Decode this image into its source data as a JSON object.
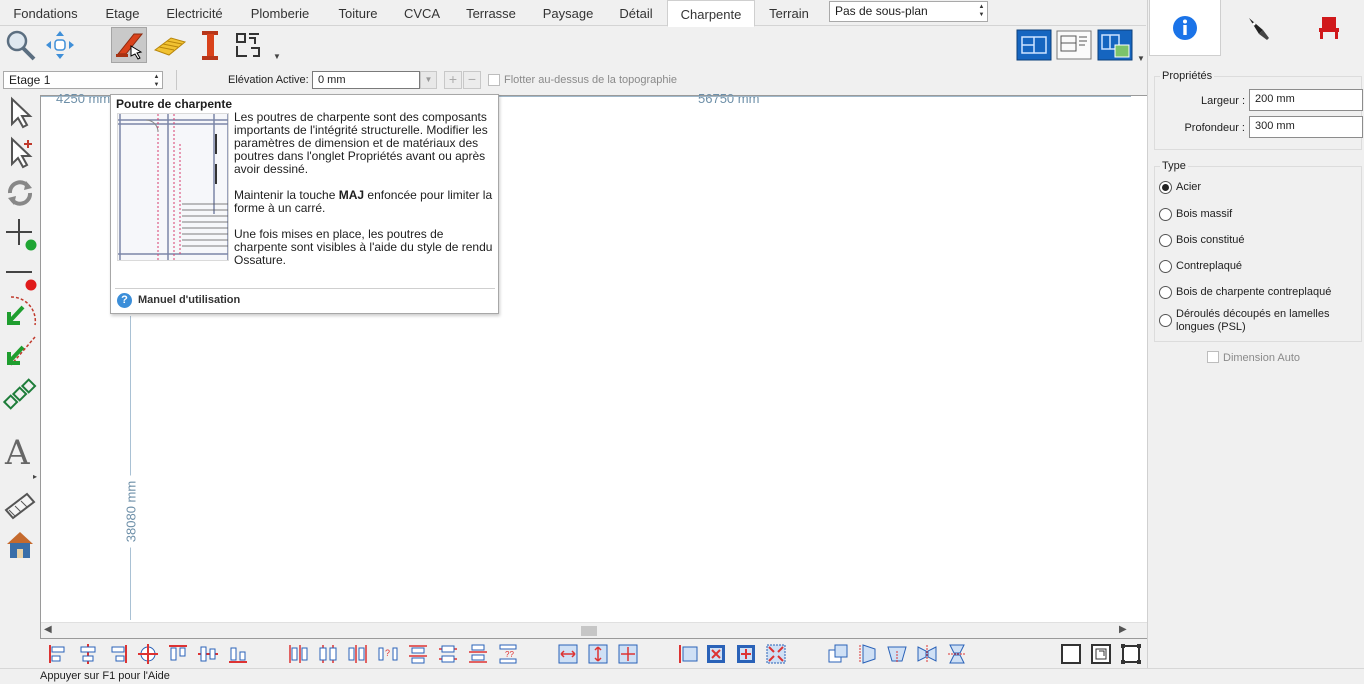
{
  "tabs": [
    "Fondations",
    "Etage",
    "Electricité",
    "Plomberie",
    "Toiture",
    "CVCA",
    "Terrasse",
    "Paysage",
    "Détail",
    "Charpente",
    "Terrain"
  ],
  "active_tab": "Charpente",
  "subplan_select": "Pas de sous-plan",
  "level_select": "Etage 1",
  "elevation": {
    "label": "Elévation Active:",
    "value": "0 mm"
  },
  "float_label": "Flotter au-dessus de la topographie",
  "canvas": {
    "dim_top_left": "4250 mm",
    "dim_top_right": "56750 mm",
    "dim_left": "38080 mm"
  },
  "tooltip": {
    "title": "Poutre de charpente",
    "p1": "Les poutres de charpente sont des composants importants de l'intégrité structurelle. Modifier les paramètres de dimension et de matériaux des poutres dans l'onglet Propriétés avant ou après avoir dessiné.",
    "p2_before": "Maintenir la touche ",
    "p2_key": "MAJ",
    "p2_after": " enfoncée pour limiter la forme à un carré.",
    "p3": "Une fois mises en place, les poutres de charpente sont visibles à l'aide du style de rendu Ossature.",
    "help_link": "Manuel d'utilisation"
  },
  "properties": {
    "title": "Propriétés",
    "width_label": "Largeur :",
    "width_value": "200 mm",
    "depth_label": "Profondeur :",
    "depth_value": "300 mm"
  },
  "type_group": {
    "title": "Type",
    "options": [
      "Acier",
      "Bois massif",
      "Bois constitué",
      "Contreplaqué",
      "Bois de charpente contreplaqué",
      "Déroulés découpés en lamelles longues (PSL)"
    ],
    "selected": "Acier"
  },
  "auto_dimension": "Dimension Auto",
  "status": "Appuyer sur F1 pour l'Aide",
  "colors": {
    "accent_blue": "#1565c0",
    "beam_red": "#c0392b",
    "dim_text": "#6d8fa8"
  }
}
